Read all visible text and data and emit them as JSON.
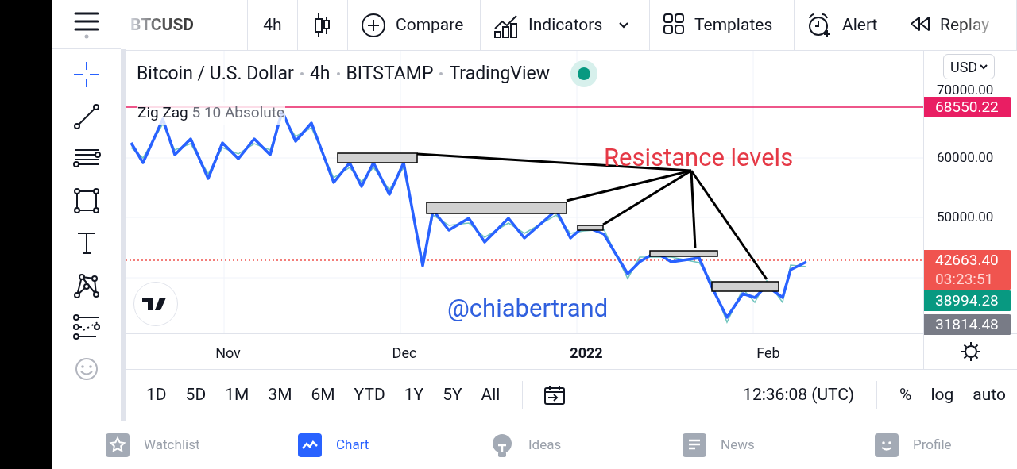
{
  "top_bar": {
    "symbol": "BTCUSD",
    "interval": "4h",
    "buttons": [
      {
        "kind": "compare",
        "label": "Compare"
      },
      {
        "kind": "indicators",
        "label": "Indicators"
      },
      {
        "kind": "templates",
        "label": "Templates"
      },
      {
        "kind": "alert",
        "label": "Alert"
      },
      {
        "kind": "replay",
        "label": "Replay"
      }
    ]
  },
  "drawing_tools": [
    {
      "kind": "crosshair",
      "selected": true
    },
    {
      "kind": "trendline",
      "selected": false
    },
    {
      "kind": "fib",
      "selected": false
    },
    {
      "kind": "rectangle",
      "selected": false
    },
    {
      "kind": "text",
      "selected": false
    },
    {
      "kind": "pattern",
      "selected": false
    },
    {
      "kind": "forecast",
      "selected": false
    },
    {
      "kind": "emoji",
      "selected": false
    }
  ],
  "legend": {
    "title": "Bitcoin / U.S. Dollar",
    "parts": [
      "4h",
      "BITSTAMP",
      "TradingView"
    ],
    "market_open": true
  },
  "indicator": {
    "name": "Zig Zag",
    "params": "5 10 Absolute"
  },
  "annotations": [
    {
      "kind": "label",
      "text": "Resistance levels"
    },
    {
      "kind": "signature",
      "text": "@chiabertrand"
    }
  ],
  "price_axis": {
    "currency": "USD",
    "ticks": [
      "70000.00",
      "60000.00",
      "50000.00"
    ],
    "badges": [
      {
        "text": "68550.22",
        "color": "#e91e63"
      },
      {
        "text": "42663.40",
        "countdown": "03:23:51",
        "color": "#f0544f"
      },
      {
        "text": "38994.28",
        "color": "#089981"
      },
      {
        "text": "31814.48",
        "color": "#787b86"
      }
    ]
  },
  "time_axis": {
    "labels": [
      {
        "text": "Nov",
        "bold": false
      },
      {
        "text": "Dec",
        "bold": false
      },
      {
        "text": "2022",
        "bold": true
      },
      {
        "text": "Feb",
        "bold": false
      }
    ]
  },
  "ranges": [
    "1D",
    "5D",
    "1M",
    "3M",
    "6M",
    "YTD",
    "1Y",
    "5Y",
    "All"
  ],
  "clock": "12:36:08 (UTC)",
  "scale_options": [
    "%",
    "log",
    "auto"
  ],
  "nav": [
    {
      "kind": "watchlist",
      "label": "Watchlist",
      "selected": false
    },
    {
      "kind": "chart",
      "label": "Chart",
      "selected": true
    },
    {
      "kind": "ideas",
      "label": "Ideas",
      "selected": false
    },
    {
      "kind": "news",
      "label": "News",
      "selected": false
    },
    {
      "kind": "profile",
      "label": "Profile",
      "selected": false
    }
  ]
}
